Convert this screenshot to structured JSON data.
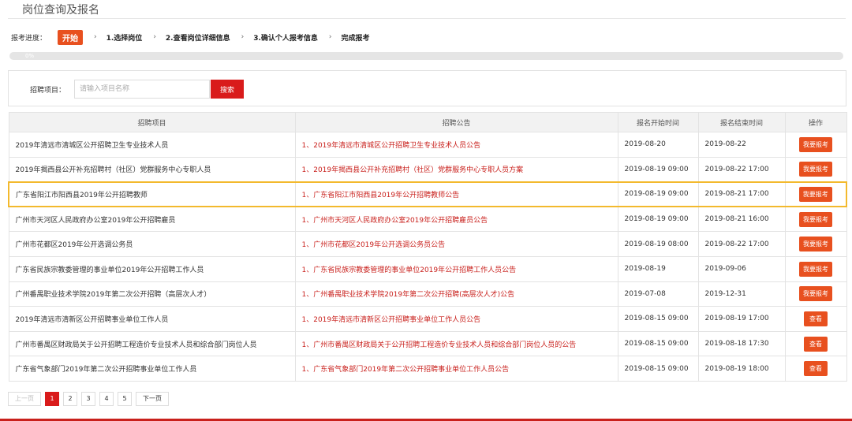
{
  "header": {
    "title": "岗位查询及报名"
  },
  "steps": {
    "label": "报考进度：",
    "start": "开始",
    "arrow": "›",
    "items": [
      "1.选择岗位",
      "2.查看岗位详细信息",
      "3.确认个人报考信息",
      "完成报考"
    ]
  },
  "progress": {
    "text": "0%",
    "value": 0
  },
  "search": {
    "label": "招聘项目：",
    "placeholder": "请输入项目名称",
    "button": "搜索"
  },
  "table": {
    "headers": [
      "招聘项目",
      "招聘公告",
      "报名开始时间",
      "报名结束时间",
      "操作"
    ],
    "rows": [
      {
        "project": "2019年清远市清城区公开招聘卫生专业技术人员",
        "notice": "1、2019年清远市清城区公开招聘卫生专业技术人员公告",
        "start": "2019-08-20",
        "end": "2019-08-22",
        "action": "我要报考"
      },
      {
        "project": "2019年揭西县公开补充招聘村（社区）党群服务中心专职人员",
        "notice": "1、2019年揭西县公开补充招聘村（社区）党群服务中心专职人员方案",
        "start": "2019-08-19 09:00",
        "end": "2019-08-22 17:00",
        "action": "我要报考"
      },
      {
        "project": "广东省阳江市阳西县2019年公开招聘教师",
        "notice": "1、广东省阳江市阳西县2019年公开招聘教师公告",
        "start": "2019-08-19 09:00",
        "end": "2019-08-21 17:00",
        "action": "我要报考"
      },
      {
        "project": "广州市天河区人民政府办公室2019年公开招聘雇员",
        "notice": "1、广州市天河区人民政府办公室2019年公开招聘雇员公告",
        "start": "2019-08-19 09:00",
        "end": "2019-08-21 16:00",
        "action": "我要报考"
      },
      {
        "project": "广州市花都区2019年公开选调公务员",
        "notice": "1、广州市花都区2019年公开选调公务员公告",
        "start": "2019-08-19 08:00",
        "end": "2019-08-22 17:00",
        "action": "我要报考"
      },
      {
        "project": "广东省民族宗教委管理的事业单位2019年公开招聘工作人员",
        "notice": "1、广东省民族宗教委管理的事业单位2019年公开招聘工作人员公告",
        "start": "2019-08-19",
        "end": "2019-09-06",
        "action": "我要报考"
      },
      {
        "project": "广州番禺职业技术学院2019年第二次公开招聘（高层次人才）",
        "notice": "1、广州番禺职业技术学院2019年第二次公开招聘(高层次人才)公告",
        "start": "2019-07-08",
        "end": "2019-12-31",
        "action": "我要报考"
      },
      {
        "project": "2019年清远市清新区公开招聘事业单位工作人员",
        "notice": "1、2019年清远市清新区公开招聘事业单位工作人员公告",
        "start": "2019-08-15 09:00",
        "end": "2019-08-19 17:00",
        "action": "查看"
      },
      {
        "project": "广州市番禺区财政局关于公开招聘工程造价专业技术人员和综合部门岗位人员",
        "notice": "1、广州市番禺区财政局关于公开招聘工程造价专业技术人员和综合部门岗位人员的公告",
        "start": "2019-08-15 09:00",
        "end": "2019-08-18 17:30",
        "action": "查看"
      },
      {
        "project": "广东省气象部门2019年第二次公开招聘事业单位工作人员",
        "notice": "1、广东省气象部门2019年第二次公开招聘事业单位工作人员公告",
        "start": "2019-08-15 09:00",
        "end": "2019-08-19 18:00",
        "action": "查看"
      }
    ]
  },
  "pagination": {
    "prev": "上一页",
    "pages": [
      "1",
      "2",
      "3",
      "4",
      "5"
    ],
    "next": "下一页",
    "current": "1"
  },
  "colors": {
    "accent": "#e8501f",
    "primary_red": "#d91b1b",
    "notice_red": "#c9201c",
    "highlight": "#f3b92d"
  }
}
